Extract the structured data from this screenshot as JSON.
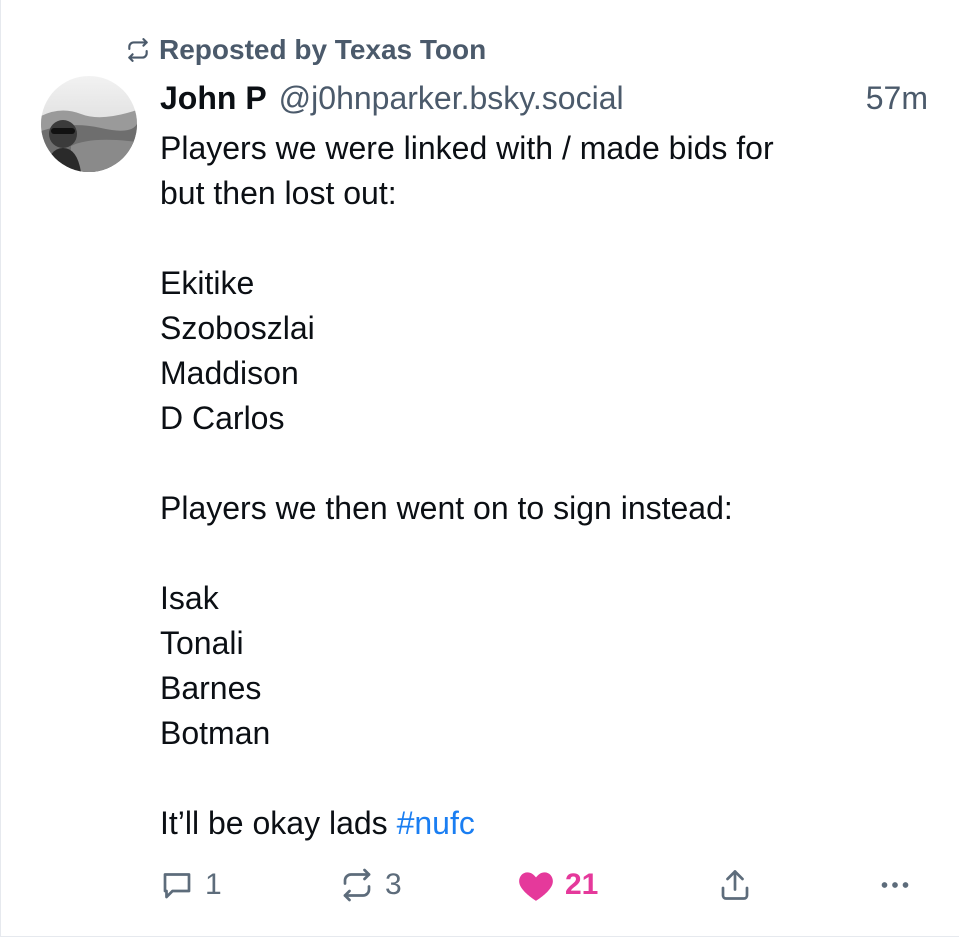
{
  "repost": {
    "label": "Reposted by Texas Toon",
    "icon": "repost-icon"
  },
  "author": {
    "name": "John P",
    "handle": "@j0hnparker.bsky.social",
    "avatar_icon": "avatar-photo"
  },
  "post": {
    "timestamp": "57m",
    "lines": {
      "l1": "Players we were linked with / made bids for",
      "l2": "but then lost out:",
      "l3": "Ekitike",
      "l4": "Szoboszlai",
      "l5": "Maddison",
      "l6": "D Carlos",
      "l7": "Players we then went on to sign instead:",
      "l8": "Isak",
      "l9": "Tonali",
      "l10": "Barnes",
      "l11": "Botman",
      "l12": "It’ll be okay lads",
      "hashtag": "#nufc"
    }
  },
  "actions": {
    "reply_count": "1",
    "repost_count": "3",
    "like_count": "21",
    "icons": {
      "reply": "reply-icon",
      "repost": "repost-icon",
      "like": "heart-icon",
      "share": "share-icon",
      "more": "more-icon"
    }
  },
  "colors": {
    "accent": "#1a7ef2",
    "like": "#e5399b",
    "muted": "#4b5a6b"
  }
}
